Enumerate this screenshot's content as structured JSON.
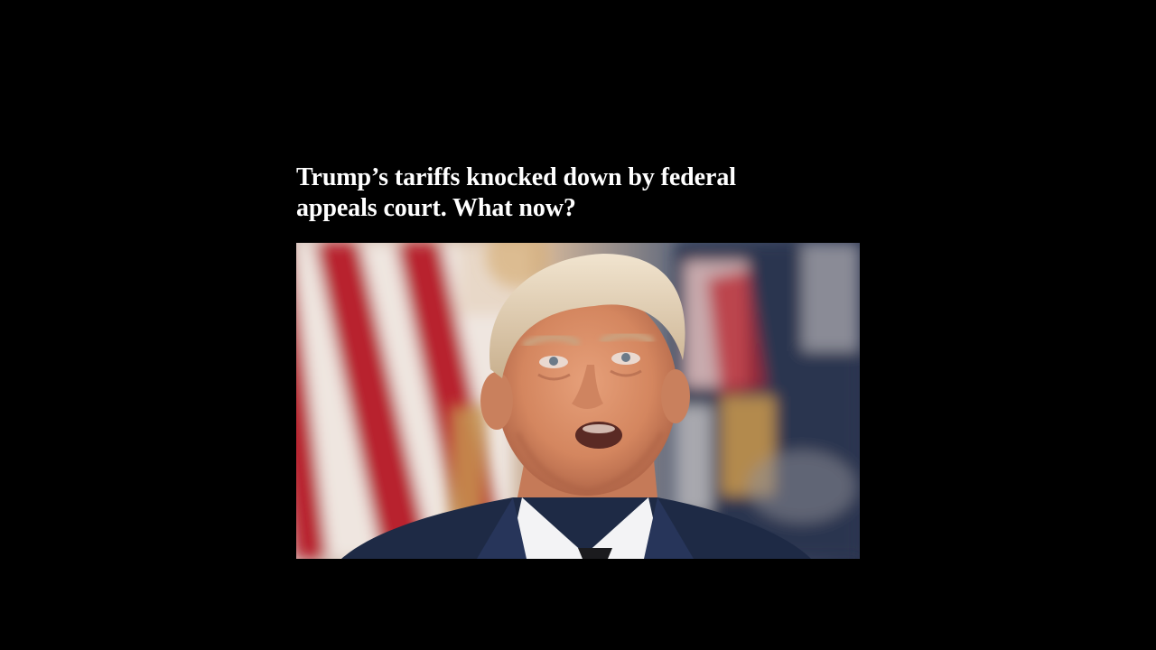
{
  "article": {
    "headline": "Trump’s tariffs knocked down by federal appeals court. What now?",
    "image": {
      "subject": "news-photo",
      "palette": {
        "background": "#000000",
        "headline_text": "#ffffff",
        "flag_red": "#b8232f",
        "flag_white": "#efe6e0",
        "flag_blue": "#23304d",
        "suit": "#1e2a45",
        "skin": "#d98f6a",
        "hair": "#e7d6bd"
      }
    }
  }
}
